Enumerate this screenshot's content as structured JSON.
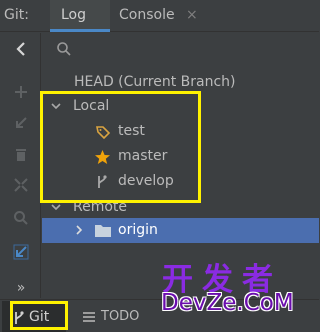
{
  "tabbar": {
    "prefix": "Git:",
    "tabs": [
      {
        "label": "Log"
      },
      {
        "label": "Console"
      }
    ],
    "close_glyph": "×"
  },
  "sidebar": {
    "icons": [
      "arrow-left-icon",
      "plus-icon",
      "arrow-down-left-icon",
      "trash-icon",
      "merge-icon",
      "search-icon",
      "arrow-down-left-icon",
      "more-icon"
    ],
    "more_label": "»"
  },
  "tree": {
    "search_icon": "search-icon",
    "head_label": "HEAD (Current Branch)",
    "local": {
      "label": "Local",
      "branches": [
        {
          "label": "test",
          "icon": "tag-icon"
        },
        {
          "label": "master",
          "icon": "star-icon"
        },
        {
          "label": "develop",
          "icon": "branch-icon"
        }
      ]
    },
    "remote": {
      "label": "Remote",
      "children": [
        {
          "label": "origin",
          "icon": "folder-icon"
        }
      ]
    }
  },
  "bottombar": {
    "git_label": "Git",
    "todo_label": "TODO"
  },
  "watermark": {
    "cn": "开发者",
    "en": "DevZe.CoM"
  },
  "colors": {
    "background": "#3c3f41",
    "selection": "#4b6eaf",
    "tab_underline": "#4a88c7",
    "highlight": "#fff200",
    "star": "#f0a30a",
    "tag": "#d9a441"
  }
}
